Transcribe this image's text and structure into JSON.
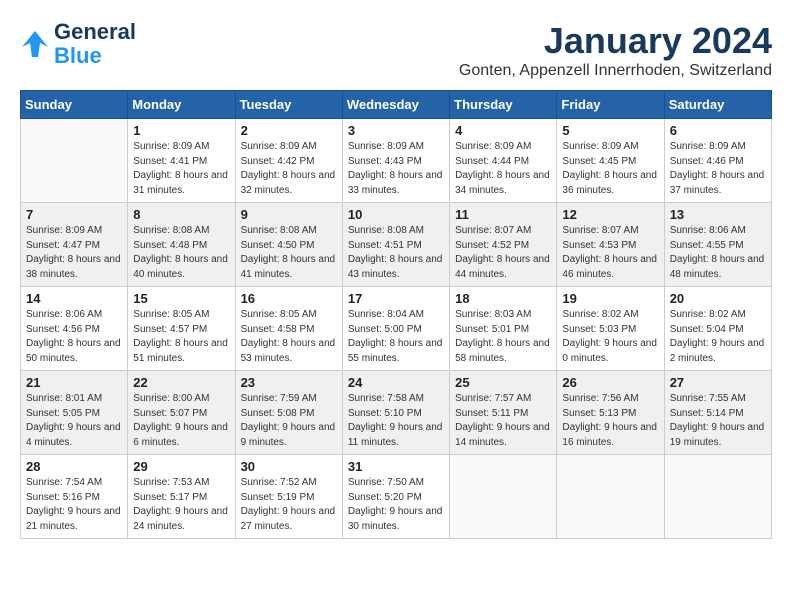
{
  "header": {
    "logo_line1": "General",
    "logo_line2": "Blue",
    "title": "January 2024",
    "subtitle": "Gonten, Appenzell Innerrhoden, Switzerland"
  },
  "weekdays": [
    "Sunday",
    "Monday",
    "Tuesday",
    "Wednesday",
    "Thursday",
    "Friday",
    "Saturday"
  ],
  "rows": [
    [
      {
        "day": "",
        "sunrise": "",
        "sunset": "",
        "daylight": ""
      },
      {
        "day": "1",
        "sunrise": "Sunrise: 8:09 AM",
        "sunset": "Sunset: 4:41 PM",
        "daylight": "Daylight: 8 hours and 31 minutes."
      },
      {
        "day": "2",
        "sunrise": "Sunrise: 8:09 AM",
        "sunset": "Sunset: 4:42 PM",
        "daylight": "Daylight: 8 hours and 32 minutes."
      },
      {
        "day": "3",
        "sunrise": "Sunrise: 8:09 AM",
        "sunset": "Sunset: 4:43 PM",
        "daylight": "Daylight: 8 hours and 33 minutes."
      },
      {
        "day": "4",
        "sunrise": "Sunrise: 8:09 AM",
        "sunset": "Sunset: 4:44 PM",
        "daylight": "Daylight: 8 hours and 34 minutes."
      },
      {
        "day": "5",
        "sunrise": "Sunrise: 8:09 AM",
        "sunset": "Sunset: 4:45 PM",
        "daylight": "Daylight: 8 hours and 36 minutes."
      },
      {
        "day": "6",
        "sunrise": "Sunrise: 8:09 AM",
        "sunset": "Sunset: 4:46 PM",
        "daylight": "Daylight: 8 hours and 37 minutes."
      }
    ],
    [
      {
        "day": "7",
        "sunrise": "Sunrise: 8:09 AM",
        "sunset": "Sunset: 4:47 PM",
        "daylight": "Daylight: 8 hours and 38 minutes."
      },
      {
        "day": "8",
        "sunrise": "Sunrise: 8:08 AM",
        "sunset": "Sunset: 4:48 PM",
        "daylight": "Daylight: 8 hours and 40 minutes."
      },
      {
        "day": "9",
        "sunrise": "Sunrise: 8:08 AM",
        "sunset": "Sunset: 4:50 PM",
        "daylight": "Daylight: 8 hours and 41 minutes."
      },
      {
        "day": "10",
        "sunrise": "Sunrise: 8:08 AM",
        "sunset": "Sunset: 4:51 PM",
        "daylight": "Daylight: 8 hours and 43 minutes."
      },
      {
        "day": "11",
        "sunrise": "Sunrise: 8:07 AM",
        "sunset": "Sunset: 4:52 PM",
        "daylight": "Daylight: 8 hours and 44 minutes."
      },
      {
        "day": "12",
        "sunrise": "Sunrise: 8:07 AM",
        "sunset": "Sunset: 4:53 PM",
        "daylight": "Daylight: 8 hours and 46 minutes."
      },
      {
        "day": "13",
        "sunrise": "Sunrise: 8:06 AM",
        "sunset": "Sunset: 4:55 PM",
        "daylight": "Daylight: 8 hours and 48 minutes."
      }
    ],
    [
      {
        "day": "14",
        "sunrise": "Sunrise: 8:06 AM",
        "sunset": "Sunset: 4:56 PM",
        "daylight": "Daylight: 8 hours and 50 minutes."
      },
      {
        "day": "15",
        "sunrise": "Sunrise: 8:05 AM",
        "sunset": "Sunset: 4:57 PM",
        "daylight": "Daylight: 8 hours and 51 minutes."
      },
      {
        "day": "16",
        "sunrise": "Sunrise: 8:05 AM",
        "sunset": "Sunset: 4:58 PM",
        "daylight": "Daylight: 8 hours and 53 minutes."
      },
      {
        "day": "17",
        "sunrise": "Sunrise: 8:04 AM",
        "sunset": "Sunset: 5:00 PM",
        "daylight": "Daylight: 8 hours and 55 minutes."
      },
      {
        "day": "18",
        "sunrise": "Sunrise: 8:03 AM",
        "sunset": "Sunset: 5:01 PM",
        "daylight": "Daylight: 8 hours and 58 minutes."
      },
      {
        "day": "19",
        "sunrise": "Sunrise: 8:02 AM",
        "sunset": "Sunset: 5:03 PM",
        "daylight": "Daylight: 9 hours and 0 minutes."
      },
      {
        "day": "20",
        "sunrise": "Sunrise: 8:02 AM",
        "sunset": "Sunset: 5:04 PM",
        "daylight": "Daylight: 9 hours and 2 minutes."
      }
    ],
    [
      {
        "day": "21",
        "sunrise": "Sunrise: 8:01 AM",
        "sunset": "Sunset: 5:05 PM",
        "daylight": "Daylight: 9 hours and 4 minutes."
      },
      {
        "day": "22",
        "sunrise": "Sunrise: 8:00 AM",
        "sunset": "Sunset: 5:07 PM",
        "daylight": "Daylight: 9 hours and 6 minutes."
      },
      {
        "day": "23",
        "sunrise": "Sunrise: 7:59 AM",
        "sunset": "Sunset: 5:08 PM",
        "daylight": "Daylight: 9 hours and 9 minutes."
      },
      {
        "day": "24",
        "sunrise": "Sunrise: 7:58 AM",
        "sunset": "Sunset: 5:10 PM",
        "daylight": "Daylight: 9 hours and 11 minutes."
      },
      {
        "day": "25",
        "sunrise": "Sunrise: 7:57 AM",
        "sunset": "Sunset: 5:11 PM",
        "daylight": "Daylight: 9 hours and 14 minutes."
      },
      {
        "day": "26",
        "sunrise": "Sunrise: 7:56 AM",
        "sunset": "Sunset: 5:13 PM",
        "daylight": "Daylight: 9 hours and 16 minutes."
      },
      {
        "day": "27",
        "sunrise": "Sunrise: 7:55 AM",
        "sunset": "Sunset: 5:14 PM",
        "daylight": "Daylight: 9 hours and 19 minutes."
      }
    ],
    [
      {
        "day": "28",
        "sunrise": "Sunrise: 7:54 AM",
        "sunset": "Sunset: 5:16 PM",
        "daylight": "Daylight: 9 hours and 21 minutes."
      },
      {
        "day": "29",
        "sunrise": "Sunrise: 7:53 AM",
        "sunset": "Sunset: 5:17 PM",
        "daylight": "Daylight: 9 hours and 24 minutes."
      },
      {
        "day": "30",
        "sunrise": "Sunrise: 7:52 AM",
        "sunset": "Sunset: 5:19 PM",
        "daylight": "Daylight: 9 hours and 27 minutes."
      },
      {
        "day": "31",
        "sunrise": "Sunrise: 7:50 AM",
        "sunset": "Sunset: 5:20 PM",
        "daylight": "Daylight: 9 hours and 30 minutes."
      },
      {
        "day": "",
        "sunrise": "",
        "sunset": "",
        "daylight": ""
      },
      {
        "day": "",
        "sunrise": "",
        "sunset": "",
        "daylight": ""
      },
      {
        "day": "",
        "sunrise": "",
        "sunset": "",
        "daylight": ""
      }
    ]
  ]
}
